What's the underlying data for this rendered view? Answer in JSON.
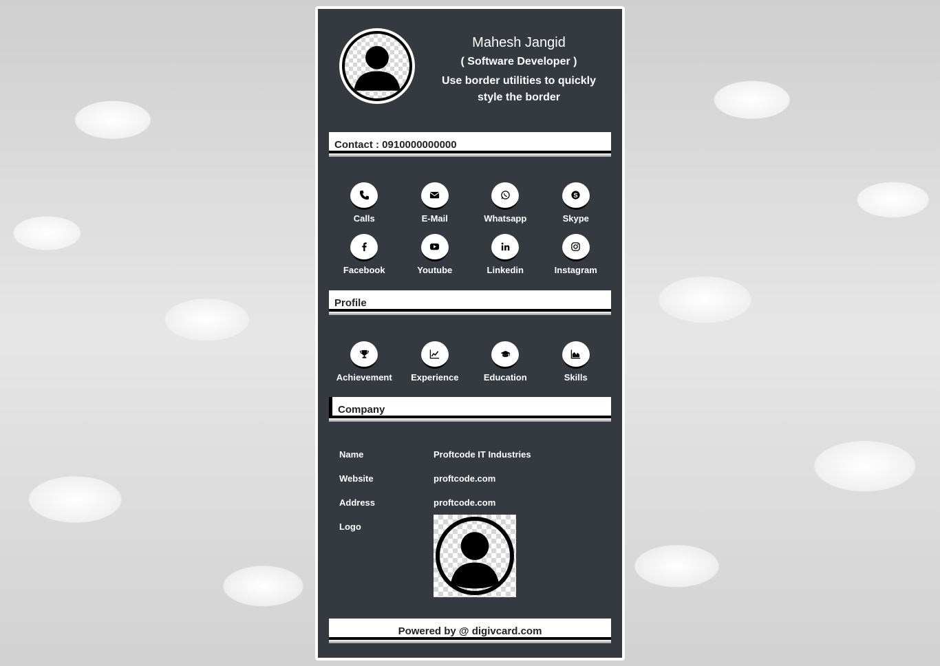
{
  "profile": {
    "name": "Mahesh Jangid",
    "role": "( Software Developer )",
    "tagline": "Use border utilities to quickly style the border"
  },
  "contact": {
    "label": "Contact : 0910000000000"
  },
  "contact_icons": [
    {
      "label": "Calls",
      "icon": "phone-icon"
    },
    {
      "label": "E-Mail",
      "icon": "envelope-icon"
    },
    {
      "label": "Whatsapp",
      "icon": "whatsapp-icon"
    },
    {
      "label": "Skype",
      "icon": "skype-icon"
    },
    {
      "label": "Facebook",
      "icon": "facebook-icon"
    },
    {
      "label": "Youtube",
      "icon": "youtube-icon"
    },
    {
      "label": "Linkedin",
      "icon": "linkedin-icon"
    },
    {
      "label": "Instagram",
      "icon": "instagram-icon"
    }
  ],
  "profile_section": {
    "title": "Profile",
    "items": [
      {
        "label": "Achievement",
        "icon": "trophy-icon"
      },
      {
        "label": "Experience",
        "icon": "line-chart-icon"
      },
      {
        "label": "Education",
        "icon": "graduation-cap-icon"
      },
      {
        "label": "Skills",
        "icon": "area-chart-icon"
      }
    ]
  },
  "company": {
    "title": "Company",
    "rows": [
      {
        "key": "Name",
        "value": "Proftcode IT Industries"
      },
      {
        "key": "Website",
        "value": "proftcode.com"
      },
      {
        "key": "Address",
        "value": "proftcode.com"
      },
      {
        "key": "Logo",
        "value": ""
      }
    ]
  },
  "footer": {
    "text": "Powered by @ digivcard.com"
  },
  "colors": {
    "card_background": "#343a40",
    "bar_background": "#ffffff",
    "text_light": "#ffffff"
  }
}
